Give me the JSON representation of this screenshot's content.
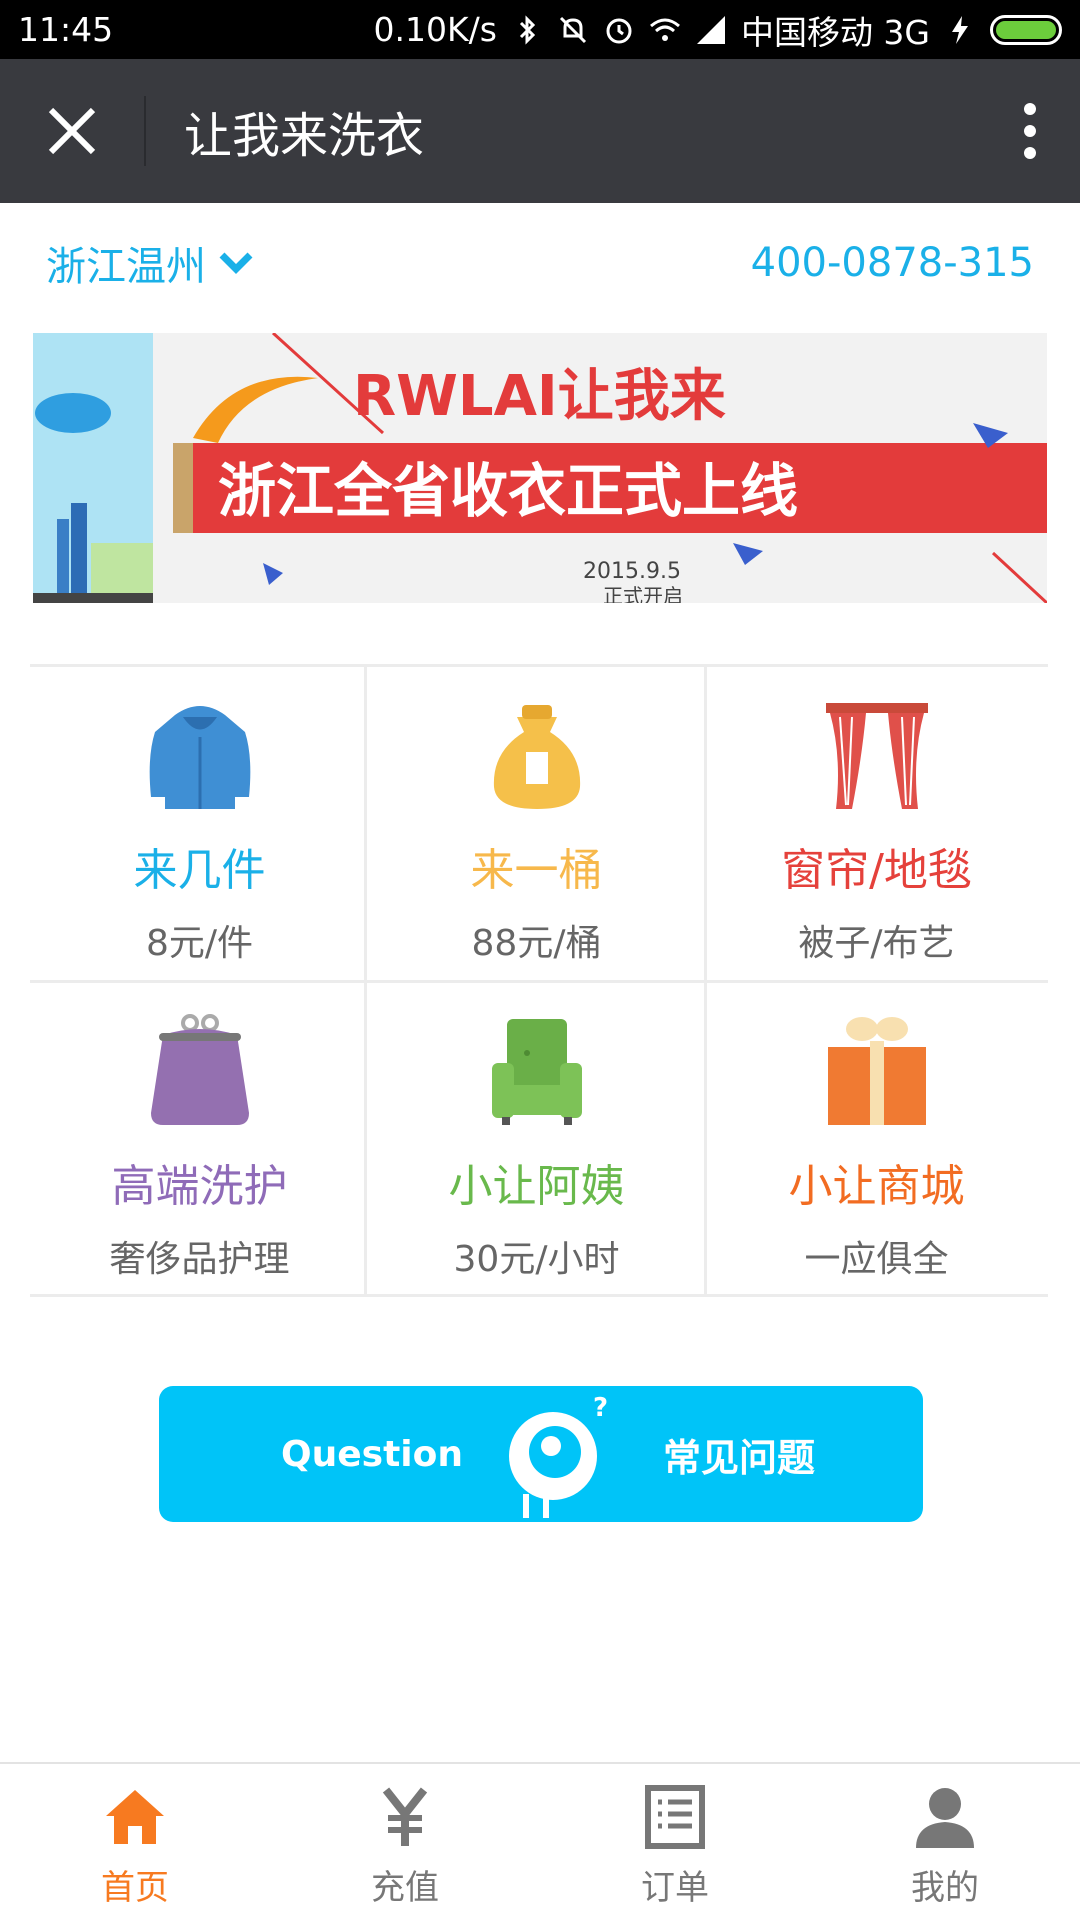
{
  "status_bar": {
    "time": "11:45",
    "speed": "0.10K/s",
    "carrier": "中国移动 3G"
  },
  "title_bar": {
    "title": "让我来洗衣",
    "close_icon": "close-icon",
    "more_icon": "more-vertical-icon"
  },
  "location": {
    "city": "浙江温州",
    "phone": "400-0878-315"
  },
  "banner": {
    "brand": "RWLAI让我来",
    "headline": "浙江全省收衣正式上线",
    "date": "2015.9.5",
    "note": "正式开启"
  },
  "services": [
    {
      "name": "来几件",
      "sub": "8元/件",
      "color": "#1ab0e8",
      "icon": "hoodie-icon"
    },
    {
      "name": "来一桶",
      "sub": "88元/桶",
      "color": "#f7b84b",
      "icon": "laundry-bag-icon"
    },
    {
      "name": "窗帘/地毯",
      "sub": "被子/布艺",
      "color": "#e5413b",
      "icon": "curtain-icon"
    },
    {
      "name": "高端洗护",
      "sub": "奢侈品护理",
      "color": "#8f6bb8",
      "icon": "purse-icon"
    },
    {
      "name": "小让阿姨",
      "sub": "30元/小时",
      "color": "#69b94c",
      "icon": "armchair-icon"
    },
    {
      "name": "小让商城",
      "sub": "一应俱全",
      "color": "#f26c22",
      "icon": "gift-icon"
    }
  ],
  "question_banner": {
    "en": "Question",
    "cn": "常见问题"
  },
  "bottom_nav": [
    {
      "label": "首页",
      "icon": "home-icon",
      "active": true
    },
    {
      "label": "充值",
      "icon": "yen-icon",
      "active": false
    },
    {
      "label": "订单",
      "icon": "order-list-icon",
      "active": false
    },
    {
      "label": "我的",
      "icon": "user-icon",
      "active": false
    }
  ],
  "colors": {
    "accent": "#1ab0e8",
    "titlebar": "#393a3f",
    "nav_active": "#f77a20",
    "question_bg": "#00c4f8"
  }
}
